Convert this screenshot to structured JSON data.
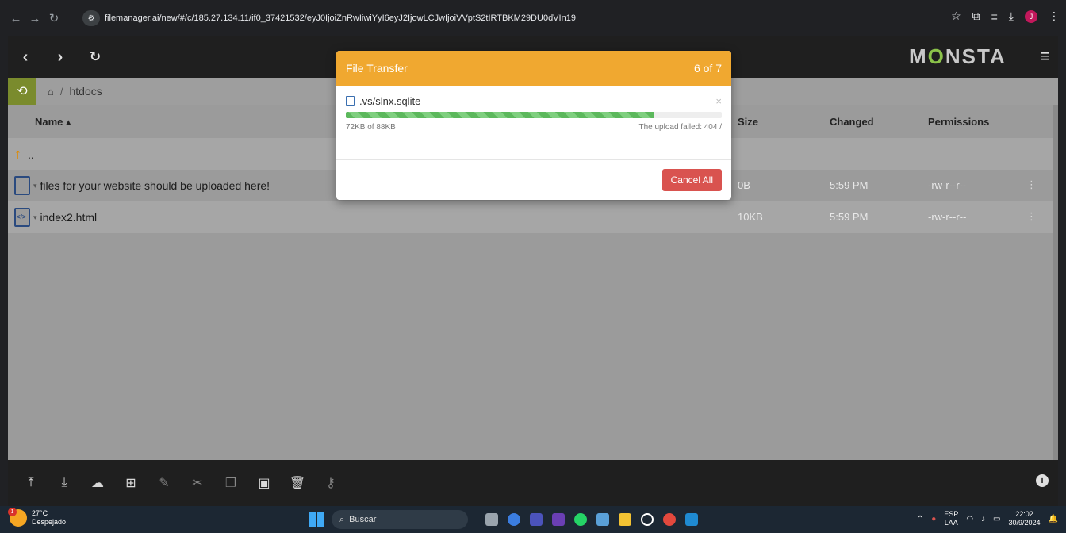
{
  "browser": {
    "url": "filemanager.ai/new/#/c/185.27.134.11/if0_37421532/eyJ0IjoiZnRwIiwiYyI6eyJ2IjowLCJwIjoiVVptS2tIRTBKM29DU0dVIn19",
    "profile_initial": "J"
  },
  "app": {
    "logo_prefix": "M",
    "logo_o": "O",
    "logo_suffix": "NSTA"
  },
  "breadcrumb": {
    "current": "htdocs",
    "separator": "/"
  },
  "file_list": {
    "columns": {
      "name": "Name ▴",
      "size": "Size",
      "changed": "Changed",
      "permissions": "Permissions"
    },
    "parent_label": "..",
    "rows": [
      {
        "name": "files for your website should be uploaded here!",
        "size": "0B",
        "changed": "5:59 PM",
        "permissions": "-rw-r--r--"
      },
      {
        "name": "index2.html",
        "size": "10KB",
        "changed": "5:59 PM",
        "permissions": "-rw-r--r--"
      }
    ]
  },
  "dialog": {
    "title": "File Transfer",
    "counter": "6 of 7",
    "file_name": ".vs/slnx.sqlite",
    "close_glyph": "×",
    "progress_fraction": 0.82,
    "transferred": "72KB of 88KB",
    "status": "The upload failed: 404 /",
    "cancel_label": "Cancel All"
  },
  "taskbar": {
    "weather_temp": "27°C",
    "weather_desc": "Despejado",
    "weather_badge": "1",
    "search_placeholder": "Buscar",
    "lang_top": "ESP",
    "lang_bottom": "LAA",
    "time": "22:02",
    "date": "30/9/2024"
  },
  "colors": {
    "dialog_header": "#f0a830",
    "cancel_button": "#d9534f",
    "progress": "#5cb85c",
    "logo_accent": "#8bc34a"
  }
}
